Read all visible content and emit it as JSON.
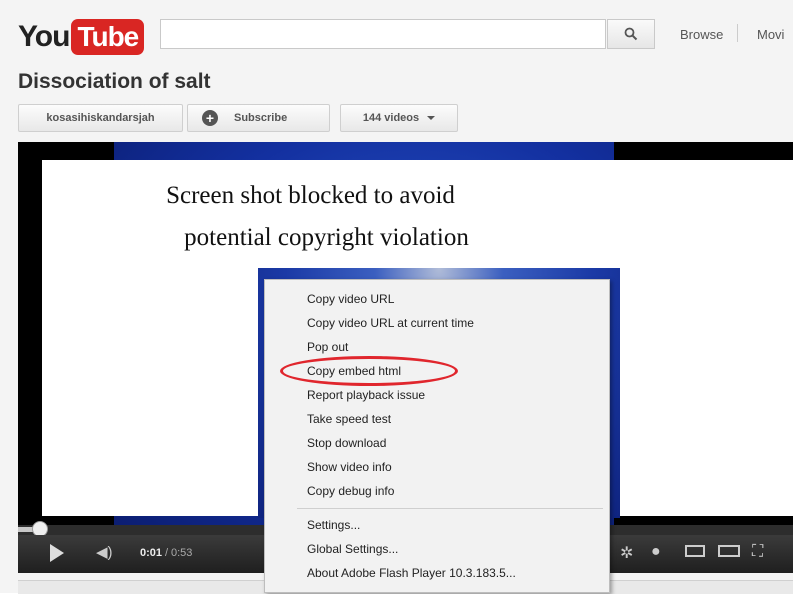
{
  "header": {
    "logo_you": "You",
    "logo_tube": "Tube",
    "search_placeholder": "",
    "nav_browse": "Browse",
    "nav_movies": "Movi"
  },
  "video": {
    "title": "Dissociation of salt",
    "channel": "kosasihiskandarsjah",
    "subscribe": "Subscribe",
    "videos_count": "144 videos"
  },
  "player": {
    "current_time": "0:01",
    "time_separator": "/",
    "duration": "0:53",
    "progress_fraction": 0.02
  },
  "overlay": {
    "line1": "Screen shot blocked to avoid",
    "line2": "potential copyright violation"
  },
  "context_menu": {
    "items": [
      "Copy video URL",
      "Copy video URL at current time",
      "Pop out",
      "Copy embed html",
      "Report playback issue",
      "Take speed test",
      "Stop download",
      "Show video info",
      "Copy debug info",
      "Settings...",
      "Global Settings...",
      "About Adobe Flash Player 10.3.183.5..."
    ],
    "highlighted_item": "Copy embed html",
    "highlight_color": "#e0262d"
  }
}
